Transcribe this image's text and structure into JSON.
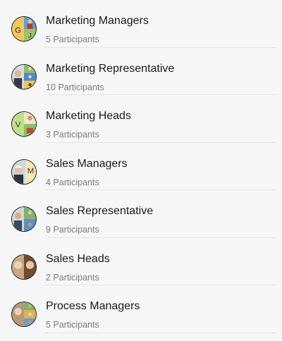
{
  "groups": [
    {
      "name": "Marketing Managers",
      "participants": "5 Participants",
      "initials": [
        "G",
        "J"
      ]
    },
    {
      "name": "Marketing Representative",
      "participants": "10 Participants",
      "initials": []
    },
    {
      "name": "Marketing Heads",
      "participants": "3 Participants",
      "initials": [
        "V"
      ]
    },
    {
      "name": "Sales Managers",
      "participants": "4 Participants",
      "initials": [
        "M"
      ]
    },
    {
      "name": "Sales Representative",
      "participants": "9 Participants",
      "initials": []
    },
    {
      "name": "Sales Heads",
      "participants": "2 Participants",
      "initials": []
    },
    {
      "name": "Process Managers",
      "participants": "5 Participants",
      "initials": []
    }
  ]
}
